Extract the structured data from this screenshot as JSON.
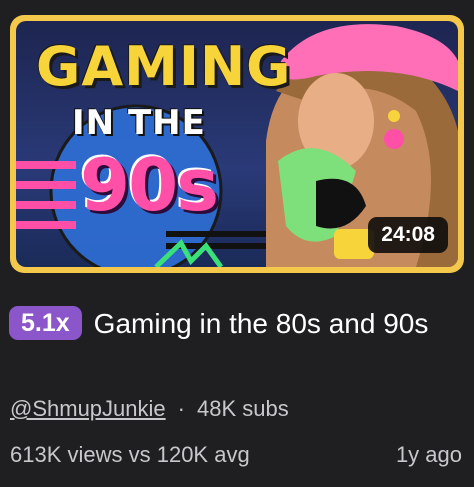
{
  "thumbnail": {
    "line1": "GAMING",
    "line2": "IN THE",
    "line3": "90s",
    "duration": "24:08"
  },
  "video": {
    "multiplier_badge": "5.1x",
    "title": "Gaming in the 80s and 90s"
  },
  "channel": {
    "handle": "@ShmupJunkie",
    "separator": "·",
    "subscribers": "48K subs"
  },
  "stats": {
    "views_vs_avg": "613K views vs 120K avg",
    "age": "1y ago"
  },
  "colors": {
    "background": "#1f1f21",
    "badge": "#8a56c9",
    "thumb_border": "#f4c84a",
    "thumb_title_yellow": "#f7d43a",
    "thumb_title_pink": "#ff4fa6",
    "meta_text": "#c8c8cc"
  }
}
